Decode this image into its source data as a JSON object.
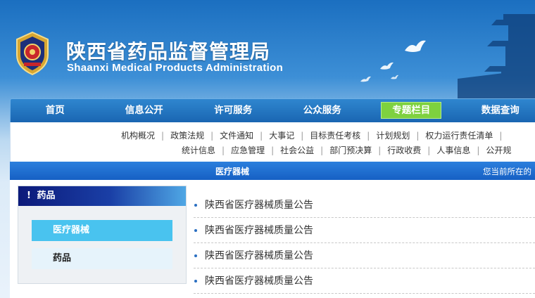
{
  "header": {
    "title_cn": "陕西省药品监督管理局",
    "title_en": "Shaanxi Medical Products Administration",
    "emblem_icon": "police-emblem-icon"
  },
  "nav": {
    "items": [
      {
        "label": "首页"
      },
      {
        "label": "信息公开"
      },
      {
        "label": "许可服务"
      },
      {
        "label": "公众服务"
      },
      {
        "label": "专题栏目"
      },
      {
        "label": "数据查询"
      }
    ],
    "active_index": 4,
    "active_color": "#7ed13f"
  },
  "subnav": {
    "row1": [
      "机构概况",
      "政策法规",
      "文件通知",
      "大事记",
      "目标责任考核",
      "计划规划",
      "权力运行责任清单"
    ],
    "row2": [
      "统计信息",
      "应急管理",
      "社会公益",
      "部门预决算",
      "行政收费",
      "人事信息",
      "公开规"
    ]
  },
  "section_bar": {
    "title": "医疗器械",
    "breadcrumb": "您当前所在的"
  },
  "sidebar": {
    "heading": "药品",
    "heading_icon": "!",
    "items": [
      {
        "label": "医疗器械"
      },
      {
        "label": "药品"
      }
    ],
    "selected_index": 0
  },
  "articles": [
    {
      "title": "陕西省医疗器械质量公告"
    },
    {
      "title": "陕西省医疗器械质量公告"
    },
    {
      "title": "陕西省医疗器械质量公告"
    },
    {
      "title": "陕西省医疗器械质量公告"
    }
  ]
}
